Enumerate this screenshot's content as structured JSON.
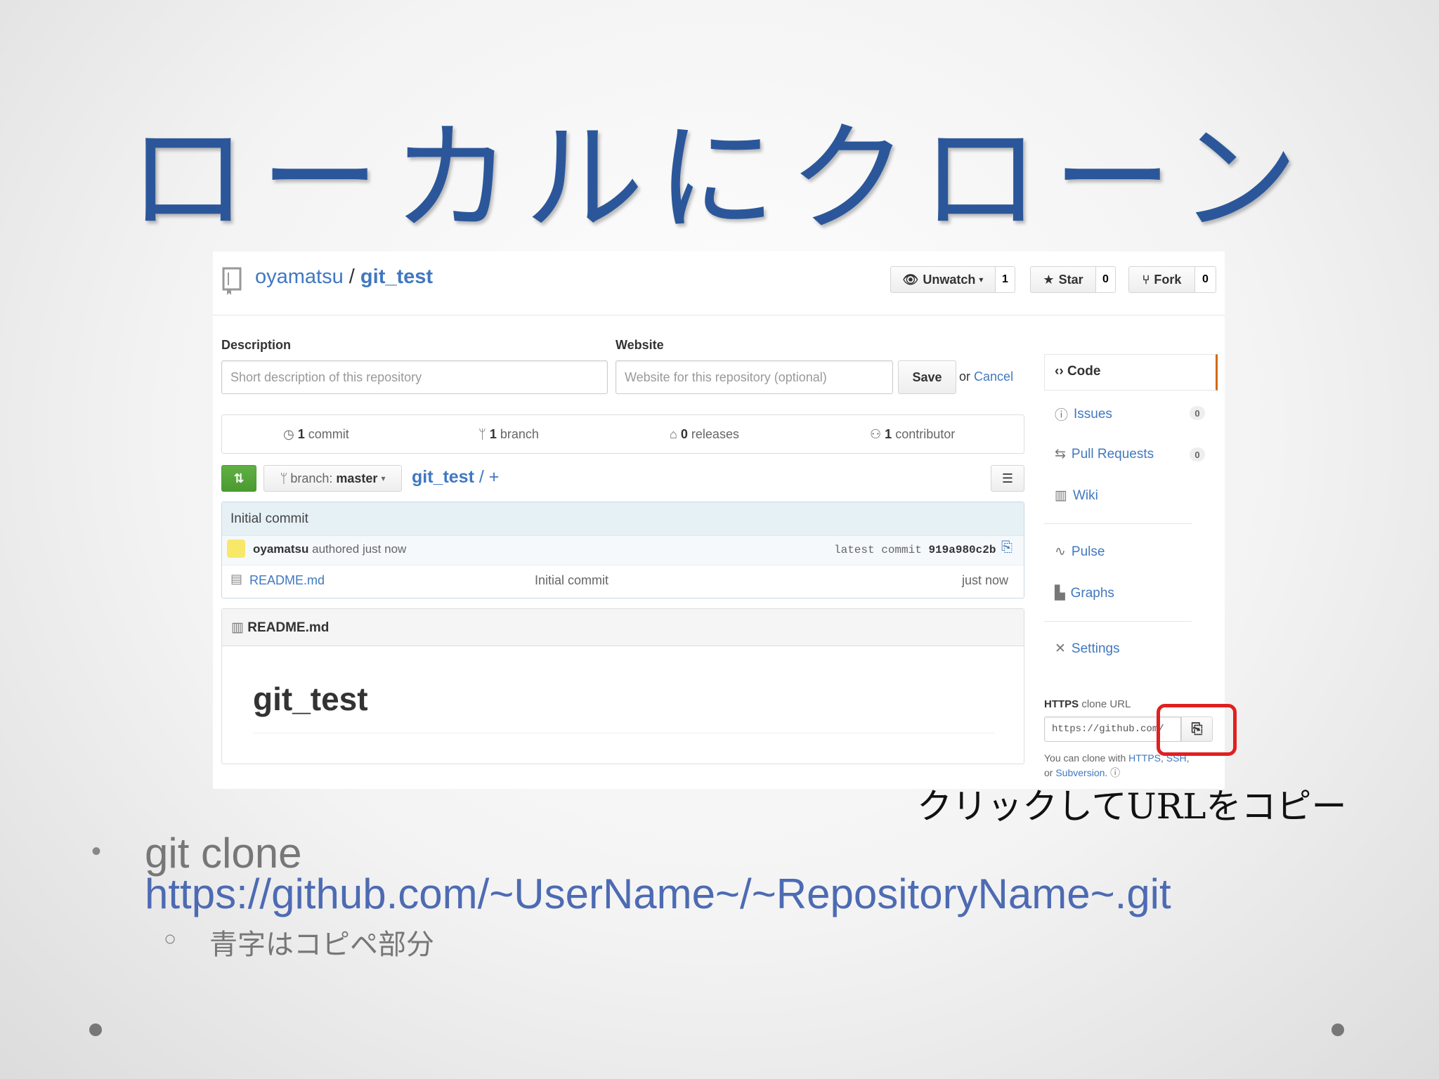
{
  "slide": {
    "title": "ローカルにクローン",
    "annotation": "クリックしてURLをコピー",
    "bullet_main": "git clone",
    "bullet_url": "https://github.com/~UserName~/~RepositoryName~.git",
    "bullet_sub": "青字はコピペ部分"
  },
  "repo": {
    "owner": "oyamatsu",
    "separator": "/",
    "name": "git_test",
    "unwatch_label": "Unwatch",
    "unwatch_count": "1",
    "star_label": "Star",
    "star_count": "0",
    "fork_label": "Fork",
    "fork_count": "0"
  },
  "edit": {
    "description_label": "Description",
    "description_placeholder": "Short description of this repository",
    "website_label": "Website",
    "website_placeholder": "Website for this repository (optional)",
    "save_label": "Save",
    "or_text": "or",
    "cancel_label": "Cancel"
  },
  "summary": {
    "commits_num": "1",
    "commits_text": "commit",
    "branches_num": "1",
    "branches_text": "branch",
    "releases_num": "0",
    "releases_text": "releases",
    "contributors_num": "1",
    "contributors_text": "contributor"
  },
  "filebar": {
    "branch_prefix": "branch:",
    "branch_name": "master",
    "path_repo": "git_test",
    "path_suffix": "/ +"
  },
  "commit": {
    "message": "Initial commit",
    "author": "oyamatsu",
    "authored_text": "authored just now",
    "latest_text": "latest commit",
    "sha": "919a980c2b"
  },
  "files": [
    {
      "name": "README.md",
      "message": "Initial commit",
      "age": "just now"
    }
  ],
  "readme": {
    "header": "README.md",
    "heading": "git_test"
  },
  "sidebar": {
    "code": "Code",
    "issues": "Issues",
    "issues_count": "0",
    "pulls": "Pull Requests",
    "pulls_count": "0",
    "wiki": "Wiki",
    "pulse": "Pulse",
    "graphs": "Graphs",
    "settings": "Settings"
  },
  "clone": {
    "label_bold": "HTTPS",
    "label_rest": "clone URL",
    "url": "https://github.com/",
    "help_prefix": "You can clone with",
    "help_https": "HTTPS",
    "help_ssh": "SSH",
    "help_or": "or",
    "help_svn": "Subversion"
  },
  "colors": {
    "title_blue": "#2b579a",
    "link_blue": "#4078c0",
    "bullet_url_blue": "#4d6bb3",
    "highlight_red": "#e02020",
    "green_button": "#55a532"
  }
}
